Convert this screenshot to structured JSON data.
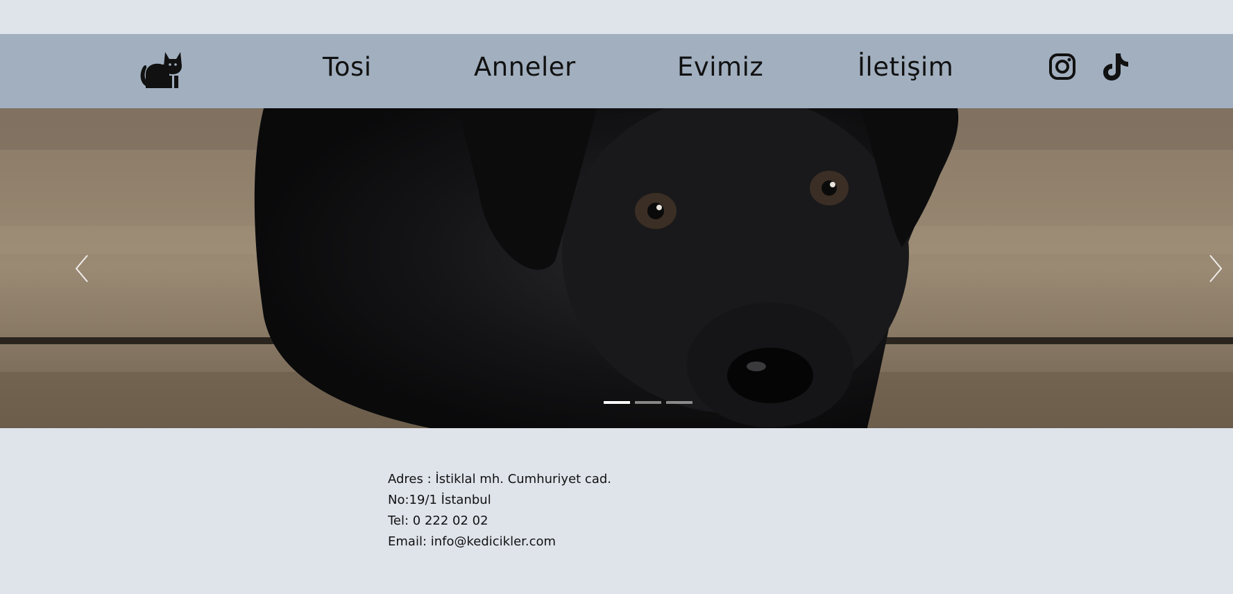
{
  "nav": {
    "logo_icon": "cat-icon",
    "links": [
      {
        "label": "Tosi"
      },
      {
        "label": "Anneler"
      },
      {
        "label": "Evimiz"
      },
      {
        "label": "İletişim"
      }
    ],
    "social": {
      "instagram_icon": "instagram-icon",
      "tiktok_icon": "tiktok-icon"
    }
  },
  "carousel": {
    "prev_icon": "chevron-left-icon",
    "next_icon": "chevron-right-icon",
    "slide_count": 3,
    "active_slide": 1
  },
  "contact": {
    "address_line1": "Adres : İstiklal mh. Cumhuriyet cad.",
    "address_line2": "No:19/1 İstanbul",
    "phone": "Tel: 0 222 02 02",
    "email": "Email: info@kedicikler.com"
  },
  "colors": {
    "page_bg": "#dfe4eb",
    "navbar_bg": "#a1afbf",
    "text": "#111111"
  }
}
